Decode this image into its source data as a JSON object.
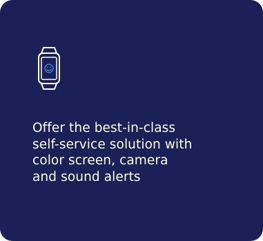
{
  "card": {
    "background_color": "#1b2157",
    "text_color": "#ffffff",
    "icon": {
      "name": "smartwatch-smiley-icon",
      "stroke_color": "#ffffff",
      "face_color": "#3a7bd5"
    },
    "description_lines": [
      "Offer the best-in-class",
      "self-service solution with",
      "color screen, camera",
      "and sound alerts"
    ]
  }
}
